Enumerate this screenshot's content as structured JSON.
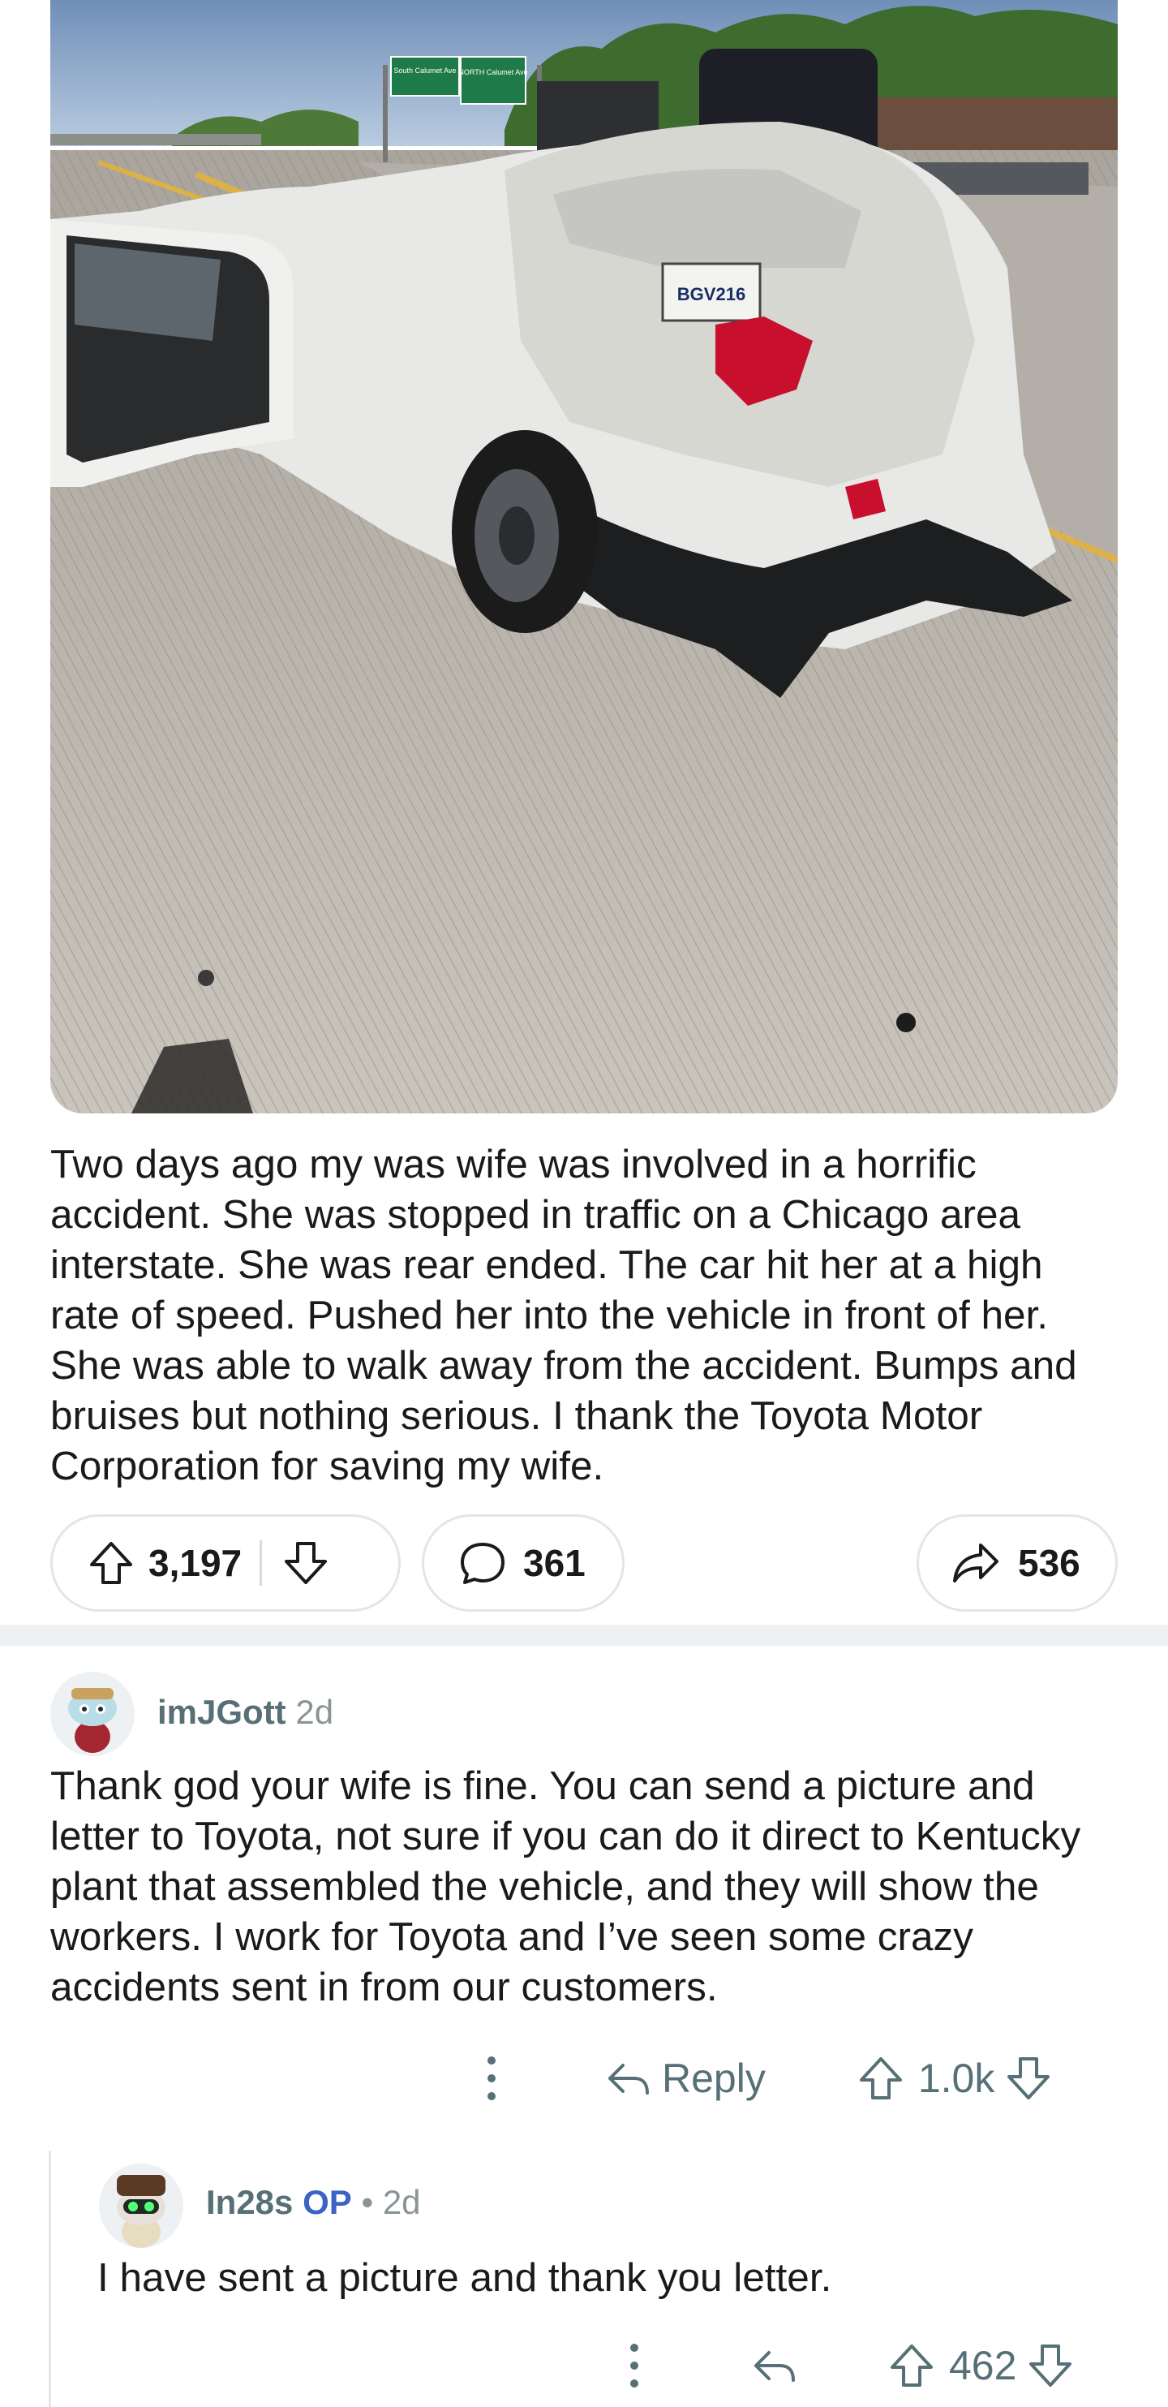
{
  "post": {
    "image_alt": "Photo of a white Toyota Camry with a crushed rear end stopped on a concrete interstate shoulder",
    "plate_text": "BGV216",
    "sign_left": "South Calumet Ave",
    "sign_right": "NORTH Calumet Ave",
    "body": "Two days ago my was wife was involved in a horrific accident. She was stopped in traffic on a Chicago area interstate. She was rear ended. The car hit her at a high rate of speed. Pushed her into the vehicle in front of her. She was able to walk away from the accident. Bumps and bruises but nothing serious. I thank the Toyota Motor Corporation for saving my wife.",
    "upvotes": "3,197",
    "comments": "361",
    "shares": "536"
  },
  "comments": [
    {
      "user": "imJGott",
      "age": "2d",
      "text": "Thank god your wife is fine. You can send a picture and letter to Toyota, not sure if you can do it direct to Kentucky plant that assembled the vehicle, and they will show the workers. I work for Toyota and I’ve seen some crazy accidents sent in from our customers.",
      "reply_label": "Reply",
      "score": "1.0k"
    },
    {
      "user": "In28s",
      "op_badge": "OP",
      "separator": "•",
      "age": "2d",
      "text": "I have sent a picture and thank you letter.",
      "score": "462"
    }
  ],
  "colors": {
    "meta_text": "#576f76",
    "op_blue": "#3b63c4",
    "pill_border": "#e3e5e7",
    "divider": "#eef0f2"
  }
}
